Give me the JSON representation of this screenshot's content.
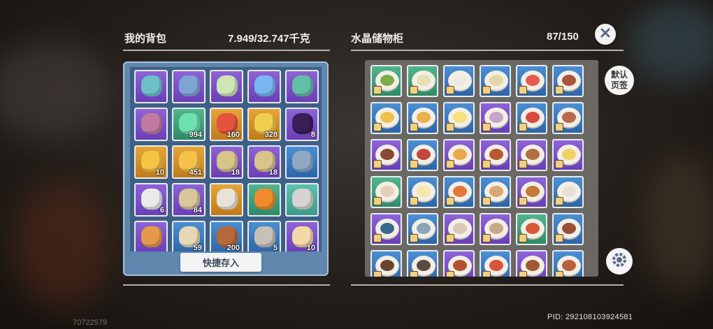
{
  "backpack": {
    "title": "我的背包",
    "weight": "7.949/32.747千克",
    "quick_store_label": "快捷存入",
    "items": [
      {
        "icon": "scythe-icon",
        "rarity": "purple",
        "count": "",
        "color": "#6cc1c7"
      },
      {
        "icon": "paintbrush-icon",
        "rarity": "purple",
        "count": "",
        "color": "#7ea4d6"
      },
      {
        "icon": "leaf-fan-icon",
        "rarity": "purple",
        "count": "",
        "color": "#cfe6b4"
      },
      {
        "icon": "feather-duster-icon",
        "rarity": "purple",
        "count": "",
        "color": "#7ab6f0"
      },
      {
        "icon": "broom-icon",
        "rarity": "purple",
        "count": "",
        "color": "#63c0a5"
      },
      {
        "icon": "fishing-rod-icon",
        "rarity": "purple",
        "count": "",
        "color": "#c07aa0"
      },
      {
        "icon": "green-crystal-icon",
        "rarity": "green",
        "count": "994",
        "color": "#6ee0b0"
      },
      {
        "icon": "red-orb-icon",
        "rarity": "gold",
        "count": "160",
        "color": "#e4533e"
      },
      {
        "icon": "cheese-cube-icon",
        "rarity": "gold",
        "count": "328",
        "color": "#f0cf50"
      },
      {
        "icon": "purple-ticket-icon",
        "rarity": "purple",
        "count": "8",
        "color": "#3a1e56"
      },
      {
        "icon": "gold-coin-icon",
        "rarity": "gold",
        "count": "10",
        "color": "#f6c445"
      },
      {
        "icon": "star-coin-icon",
        "rarity": "gold",
        "count": "451",
        "color": "#f5c14a"
      },
      {
        "icon": "scroll-card-icon",
        "rarity": "purple",
        "count": "18",
        "color": "#d9c48a"
      },
      {
        "icon": "scroll-card-icon",
        "rarity": "purple",
        "count": "18",
        "color": "#d9c48a"
      },
      {
        "icon": "blue-wing-stone-icon",
        "rarity": "blue",
        "count": "",
        "color": "#8fa8c4"
      },
      {
        "icon": "megaphone-icon",
        "rarity": "purple",
        "count": "6",
        "color": "#eaeaea"
      },
      {
        "icon": "folded-paper-icon",
        "rarity": "purple",
        "count": "84",
        "color": "#d9c69a"
      },
      {
        "icon": "horn-icon",
        "rarity": "gold",
        "count": "",
        "color": "#e8e3d8"
      },
      {
        "icon": "campfire-icon",
        "rarity": "green",
        "count": "",
        "color": "#f08a2a"
      },
      {
        "icon": "lamp-post-icon",
        "rarity": "teal",
        "count": "",
        "color": "#d7d3cf"
      },
      {
        "icon": "fox-ears-icon",
        "rarity": "purple",
        "count": "",
        "color": "#e59a4a"
      },
      {
        "icon": "cat-ears-icon",
        "rarity": "blue",
        "count": "59",
        "color": "#e8d7b5"
      },
      {
        "icon": "pie-icon",
        "rarity": "blue",
        "count": "200",
        "color": "#b8693a"
      },
      {
        "icon": "silver-medal-icon",
        "rarity": "blue",
        "count": "5",
        "color": "#c7c0b5"
      },
      {
        "icon": "paw-sack-icon",
        "rarity": "purple",
        "count": "10",
        "color": "#f3d9a6"
      }
    ]
  },
  "storage": {
    "title": "水晶储物柜",
    "capacity": "87/150",
    "default_tab_label": "默认页签",
    "items": [
      {
        "icon": "salad-dish-icon",
        "rarity": "green",
        "food": "#7cae4a"
      },
      {
        "icon": "soup-dish-icon",
        "rarity": "green",
        "food": "#e8dfb0"
      },
      {
        "icon": "empty-plate-icon",
        "rarity": "blue",
        "food": "#efeae0"
      },
      {
        "icon": "porridge-dish-icon",
        "rarity": "blue",
        "food": "#e4d7a5"
      },
      {
        "icon": "fruit-plate-icon",
        "rarity": "blue",
        "food": "#e45d4e"
      },
      {
        "icon": "steak-dish-icon",
        "rarity": "blue",
        "food": "#a9553e"
      },
      {
        "icon": "omelette-dish-icon",
        "rarity": "blue",
        "food": "#f0c04a"
      },
      {
        "icon": "pasta-dish-icon",
        "rarity": "blue",
        "food": "#eab14a"
      },
      {
        "icon": "fried-egg-dish-icon",
        "rarity": "blue",
        "food": "#f5e27a"
      },
      {
        "icon": "dessert-dish-icon",
        "rarity": "purple",
        "food": "#c9a5c9"
      },
      {
        "icon": "tomato-dish-icon",
        "rarity": "blue",
        "food": "#d84a3c"
      },
      {
        "icon": "meat-dish-icon",
        "rarity": "blue",
        "food": "#b96a4a"
      },
      {
        "icon": "meatball-dish-icon",
        "rarity": "purple",
        "food": "#8a4a32"
      },
      {
        "icon": "sausage-dish-icon",
        "rarity": "blue",
        "food": "#c4473a"
      },
      {
        "icon": "noodle-dish-icon",
        "rarity": "purple",
        "food": "#e8a84a"
      },
      {
        "icon": "curry-dish-icon",
        "rarity": "purple",
        "food": "#b7582e"
      },
      {
        "icon": "stew-dish-icon",
        "rarity": "purple",
        "food": "#b07040"
      },
      {
        "icon": "cheese-dish-icon",
        "rarity": "purple",
        "food": "#f0d065"
      },
      {
        "icon": "cream-soup-icon",
        "rarity": "green",
        "food": "#e6cfb8"
      },
      {
        "icon": "egg-bowl-icon",
        "rarity": "blue",
        "food": "#f5e8a8"
      },
      {
        "icon": "tomato-egg-icon",
        "rarity": "blue",
        "food": "#e8743c"
      },
      {
        "icon": "pie-dish-icon",
        "rarity": "blue",
        "food": "#d8a870"
      },
      {
        "icon": "tart-dish-icon",
        "rarity": "purple",
        "food": "#c47a3a"
      },
      {
        "icon": "dumpling-dish-icon",
        "rarity": "blue",
        "food": "#e8e0d5"
      },
      {
        "icon": "berry-dish-icon",
        "rarity": "purple",
        "food": "#3a6a8a"
      },
      {
        "icon": "clam-dish-icon",
        "rarity": "blue",
        "food": "#8aa6b8"
      },
      {
        "icon": "mushroom-dish-icon",
        "rarity": "purple",
        "food": "#d8c8b8"
      },
      {
        "icon": "cupcake-dish-icon",
        "rarity": "purple",
        "food": "#c8a888"
      },
      {
        "icon": "tomato-soup-icon",
        "rarity": "green",
        "food": "#d85a34"
      },
      {
        "icon": "grilled-meat-icon",
        "rarity": "blue",
        "food": "#9a5036"
      },
      {
        "icon": "tofu-dish-icon",
        "rarity": "blue",
        "food": "#6a4630"
      },
      {
        "icon": "sushi-dish-icon",
        "rarity": "blue",
        "food": "#5a4a40"
      },
      {
        "icon": "meat-stew-icon",
        "rarity": "purple",
        "food": "#b4522e"
      },
      {
        "icon": "kebab-dish-icon",
        "rarity": "blue",
        "food": "#d8543a"
      },
      {
        "icon": "chop-dish-icon",
        "rarity": "purple",
        "food": "#a05a34"
      },
      {
        "icon": "skewer-dish-icon",
        "rarity": "blue",
        "food": "#b8603a"
      }
    ]
  },
  "pid": "PID: 292108103924581",
  "uid": "70722579"
}
